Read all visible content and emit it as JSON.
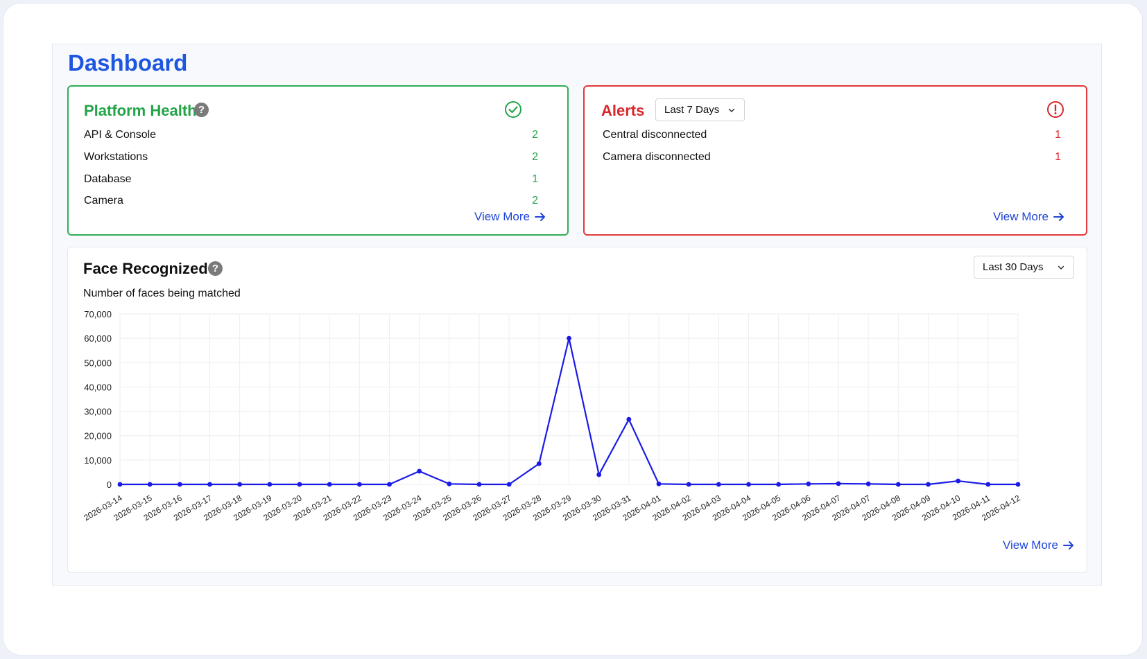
{
  "page": {
    "title": "Dashboard"
  },
  "health": {
    "title": "Platform Health",
    "items": [
      {
        "label": "API & Console",
        "value": "2"
      },
      {
        "label": "Workstations",
        "value": "2"
      },
      {
        "label": "Database",
        "value": "1"
      },
      {
        "label": "Camera",
        "value": "2"
      }
    ],
    "view_more": "View More",
    "icon": "check-circle-icon",
    "color": "#22a447"
  },
  "alerts": {
    "title": "Alerts",
    "range": "Last 7 Days",
    "items": [
      {
        "label": "Central disconnected",
        "value": "1"
      },
      {
        "label": "Camera disconnected",
        "value": "1"
      }
    ],
    "view_more": "View More",
    "icon": "alert-circle-icon",
    "color": "#d8262b"
  },
  "face": {
    "title": "Face Recognized",
    "range": "Last 30 Days",
    "subtitle": "Number of faces being matched",
    "view_more": "View More"
  },
  "chart_data": {
    "type": "line",
    "title": "Number of faces being matched",
    "xlabel": "",
    "ylabel": "",
    "ylim": [
      0,
      70000
    ],
    "yticks": [
      "0",
      "10,000",
      "20,000",
      "30,000",
      "40,000",
      "50,000",
      "60,000",
      "70,000"
    ],
    "grid": true,
    "color": "#1a1ae6",
    "x": [
      "2026-03-14",
      "2026-03-15",
      "2026-03-16",
      "2026-03-17",
      "2026-03-18",
      "2026-03-19",
      "2026-03-20",
      "2026-03-21",
      "2026-03-22",
      "2026-03-23",
      "2026-03-24",
      "2026-03-25",
      "2026-03-26",
      "2026-03-27",
      "2026-03-28",
      "2026-03-29",
      "2026-03-30",
      "2026-03-31",
      "2026-04-01",
      "2026-04-02",
      "2026-04-03",
      "2026-04-04",
      "2026-04-05",
      "2026-04-06",
      "2026-04-07",
      "2026-04-07",
      "2026-04-08",
      "2026-04-09",
      "2026-04-10",
      "2026-04-11",
      "2026-04-12"
    ],
    "y": [
      0,
      0,
      0,
      0,
      0,
      0,
      0,
      0,
      0,
      0,
      5400,
      200,
      0,
      0,
      8500,
      60000,
      4000,
      26700,
      200,
      0,
      0,
      0,
      0,
      200,
      300,
      200,
      0,
      0,
      1400,
      0,
      0
    ]
  }
}
